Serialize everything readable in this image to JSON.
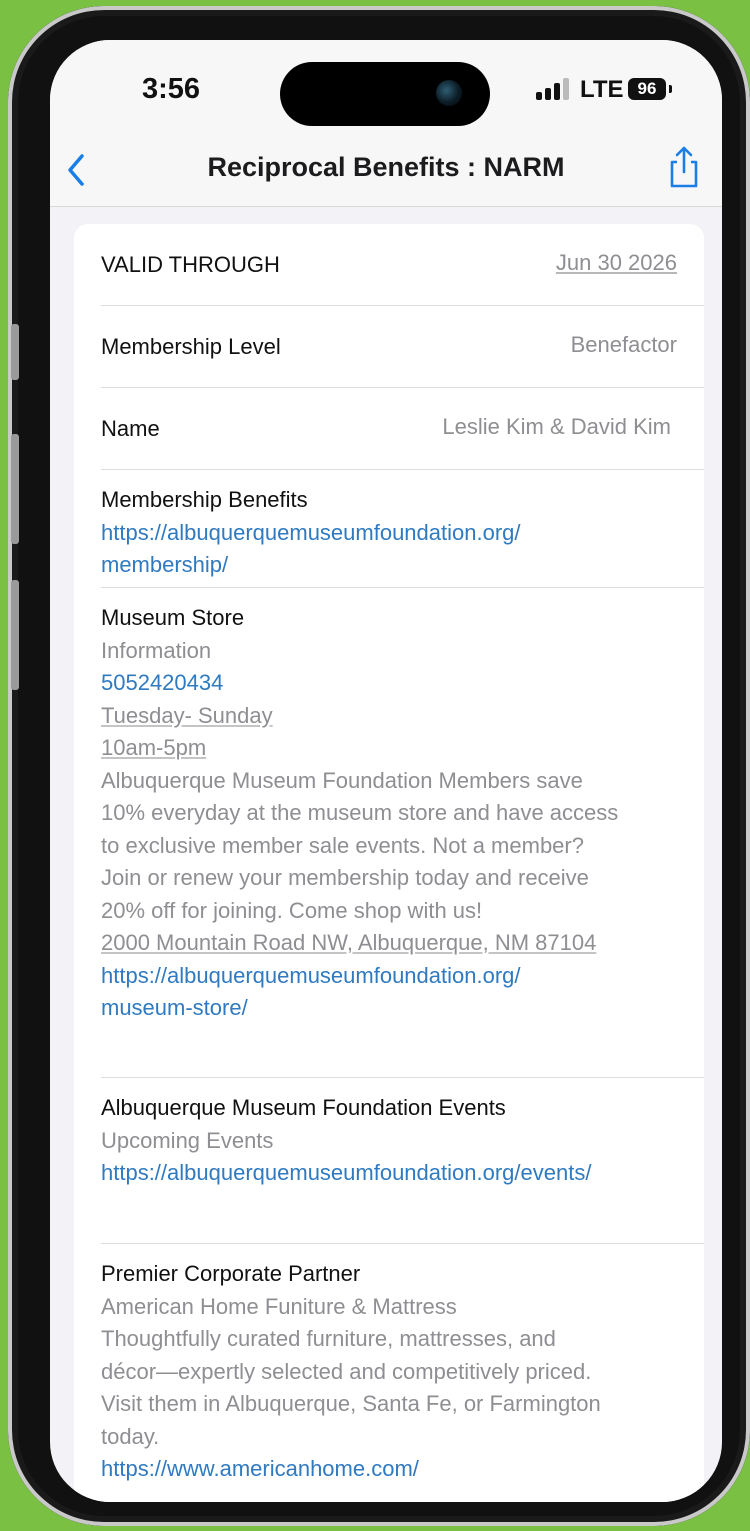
{
  "status": {
    "time": "3:56",
    "network": "LTE",
    "battery": "96"
  },
  "nav": {
    "title": "Reciprocal Benefits : NARM"
  },
  "rows": {
    "valid_through": {
      "label": "VALID THROUGH",
      "value": "Jun 30 2026"
    },
    "membership_level": {
      "label": "Membership Level",
      "value": "Benefactor"
    },
    "name": {
      "label": "Name",
      "value": "Leslie Kim & David Kim"
    }
  },
  "membership_benefits": {
    "heading": "Membership Benefits",
    "link_1": "https://albuquerquemuseumfoundation.org/",
    "link_2": "membership/"
  },
  "museum_store": {
    "heading": "Museum Store",
    "info_label": "Information",
    "phone": "5052420434",
    "days": "Tuesday- Sunday",
    "hours": "10am-5pm",
    "desc_1": "Albuquerque Museum Foundation Members save",
    "desc_2": "10% everyday at the museum store and have access",
    "desc_3": "to exclusive member sale events. Not a member?",
    "desc_4": "Join or renew your membership today and receive",
    "desc_5": "20% off for joining. Come shop with us!",
    "address": "2000 Mountain Road NW, Albuquerque, NM 87104",
    "link_1": "https://albuquerquemuseumfoundation.org/",
    "link_2": "museum-store/"
  },
  "events": {
    "heading": "Albuquerque Museum Foundation Events",
    "subtitle": "Upcoming Events",
    "link": "https://albuquerquemuseumfoundation.org/events/"
  },
  "partner": {
    "heading": "Premier Corporate Partner",
    "name": "American Home Funiture & Mattress",
    "desc_1": "Thoughtfully curated furniture, mattresses, and",
    "desc_2": "décor—expertly selected and competitively priced.",
    "desc_3": "Visit them in Albuquerque, Santa Fe, or Farmington",
    "desc_4": "today.",
    "link": "https://www.americanhome.com/"
  },
  "colors": {
    "background": "#7ac143",
    "link": "#2f7ac0",
    "secondary_text": "#8e8e93",
    "accent": "#1a7ee6"
  },
  "icons": [
    "back-chevron-icon",
    "share-icon",
    "signal-icon",
    "battery-icon",
    "camera-icon"
  ]
}
